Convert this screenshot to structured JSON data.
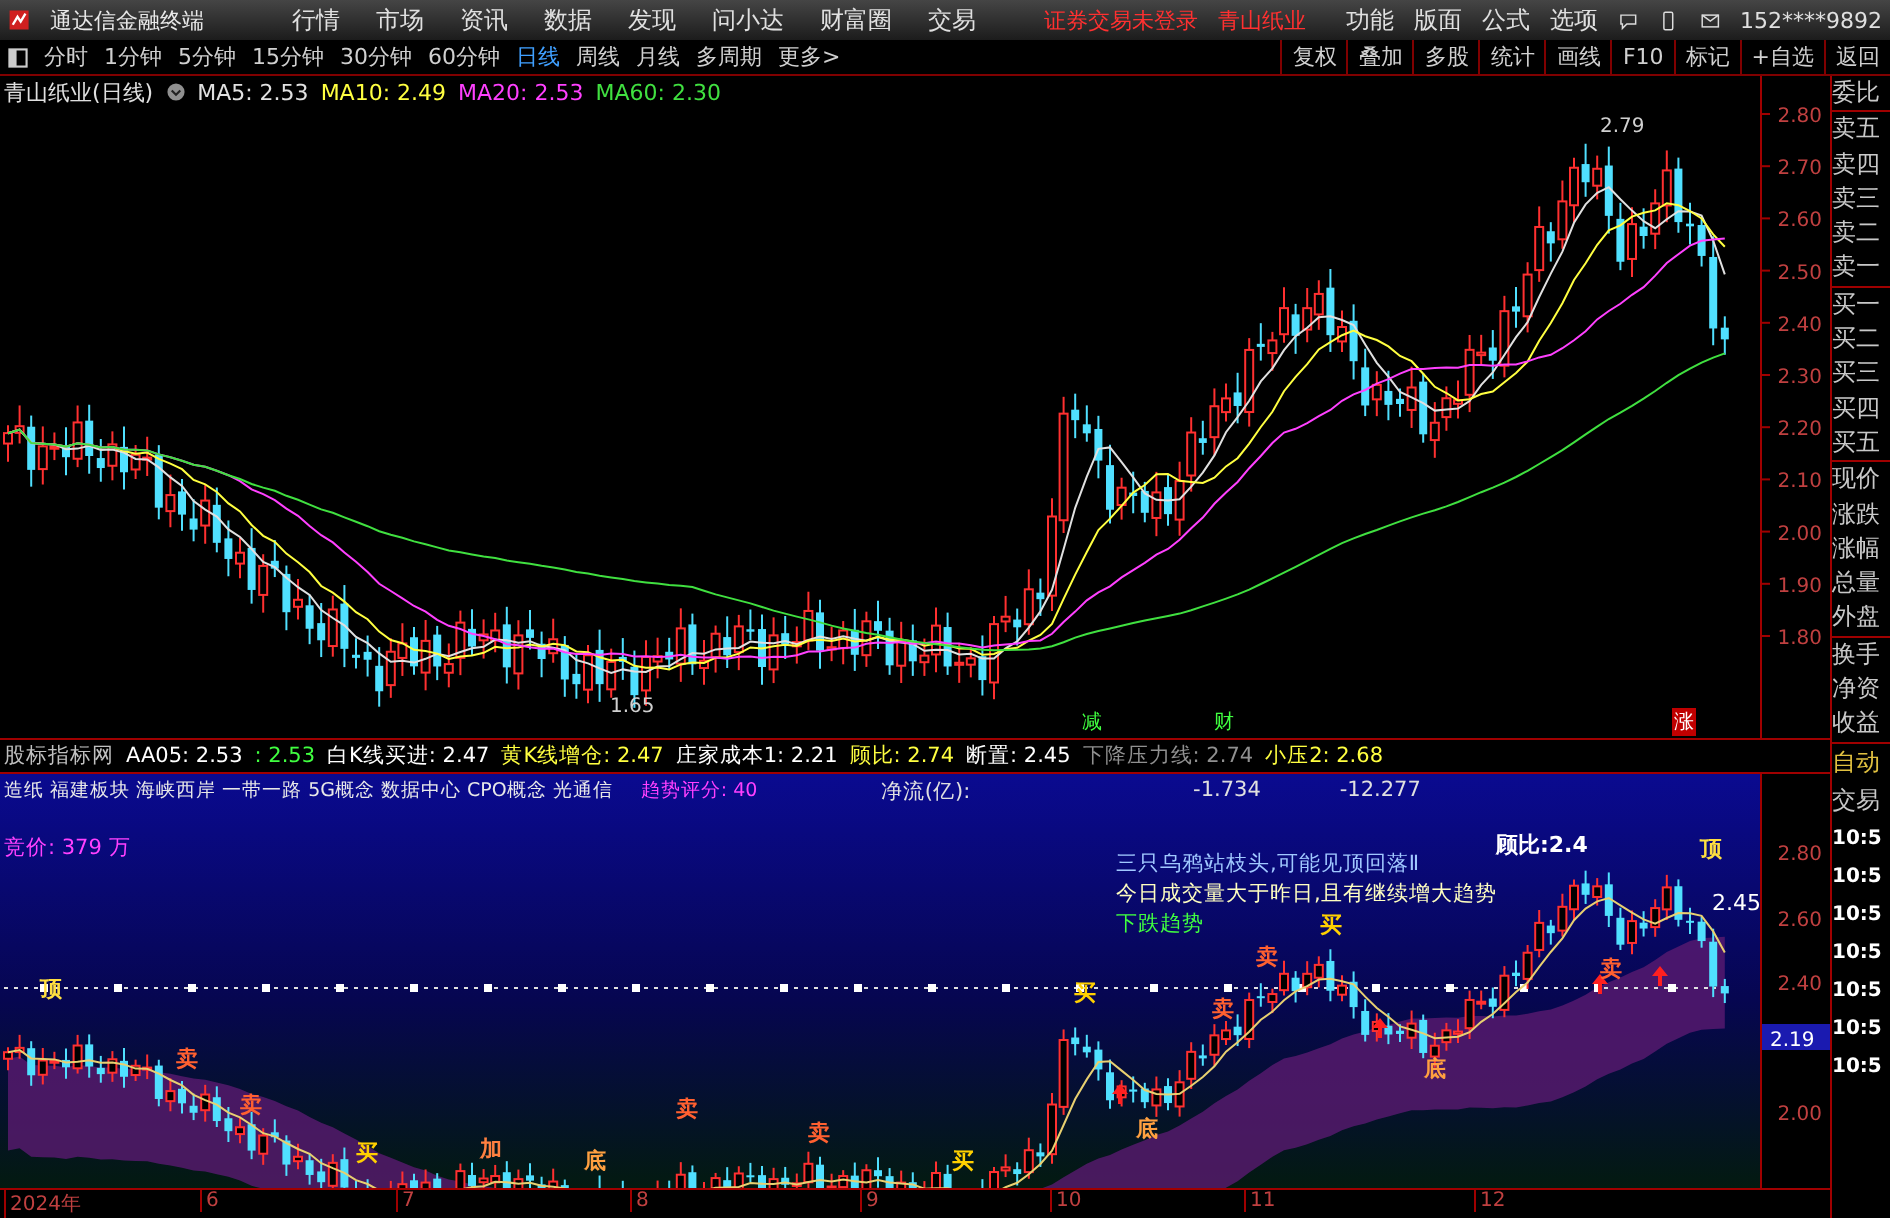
{
  "menubar": {
    "app_title": "通达信金融终端",
    "menus": [
      "行情",
      "市场",
      "资讯",
      "数据",
      "发现",
      "问小达",
      "财富圈",
      "交易"
    ],
    "login_status": "证券交易未登录",
    "stock": "青山纸业",
    "tools": [
      "功能",
      "版面",
      "公式",
      "选项"
    ],
    "account": "152****9892"
  },
  "toolbar": {
    "periods": [
      {
        "label": "分时",
        "selected": false
      },
      {
        "label": "1分钟",
        "selected": false
      },
      {
        "label": "5分钟",
        "selected": false
      },
      {
        "label": "15分钟",
        "selected": false
      },
      {
        "label": "30分钟",
        "selected": false
      },
      {
        "label": "60分钟",
        "selected": false
      },
      {
        "label": "日线",
        "selected": true
      },
      {
        "label": "周线",
        "selected": false
      },
      {
        "label": "月线",
        "selected": false
      },
      {
        "label": "多周期",
        "selected": false
      },
      {
        "label": "更多>",
        "selected": false
      }
    ],
    "actions": [
      "复权",
      "叠加",
      "多股",
      "统计",
      "画线",
      "F10",
      "标记",
      "+自选",
      "返回"
    ]
  },
  "main_chart": {
    "title": "青山纸业(日线)",
    "averages": [
      {
        "label": "MA5: 2.53",
        "color": "#e0e0e0"
      },
      {
        "label": "MA10: 2.49",
        "color": "#ffff40"
      },
      {
        "label": "MA20: 2.53",
        "color": "#ff40ff"
      },
      {
        "label": "MA60: 2.30",
        "color": "#40e040"
      }
    ],
    "price_labels": [
      "2.80",
      "2.70",
      "2.60",
      "2.50",
      "2.40",
      "2.30",
      "2.20",
      "2.10",
      "2.00",
      "1.90",
      "1.80"
    ],
    "annotations": [
      "2.79",
      "1.65"
    ],
    "events": [
      {
        "text": "减",
        "kind": "cut"
      },
      {
        "text": "财",
        "kind": "report"
      },
      {
        "text": "涨",
        "kind": "rise"
      }
    ]
  },
  "indicator": {
    "header": [
      {
        "text": "股标指标网",
        "color": "#c0c0c0"
      },
      {
        "text": "AA05: 2.53",
        "color": "#ffffff"
      },
      {
        "text": ": 2.53",
        "color": "#40ff40"
      },
      {
        "text": "白K线买进: 2.47",
        "color": "#ffffff"
      },
      {
        "text": "黄K线增仓: 2.47",
        "color": "#ffff40"
      },
      {
        "text": "庄家成本1: 2.21",
        "color": "#ffffff"
      },
      {
        "text": "顾比: 2.74",
        "color": "#ffff40"
      },
      {
        "text": "断置: 2.45",
        "color": "#ffffff"
      },
      {
        "text": "下降压力线: 2.74",
        "color": "#909090"
      },
      {
        "text": "小压2: 2.68",
        "color": "#ffff40"
      }
    ],
    "concepts": "造纸 福建板块 海峡西岸 一带一路 5G概念 数据中心 CPO概念 光通信",
    "trend_score": "趋势评分: 40",
    "net_flow_label": "净流(亿):",
    "net_flow_values": [
      "-1.734",
      "-12.277"
    ],
    "auction": "竞价: 379 万",
    "messages": [
      {
        "text": "三只乌鸦站枝头,可能见顶回落Ⅱ",
        "color": "#a0c8ff"
      },
      {
        "text": "今日成交量大于昨日,且有继续增大趋势",
        "color": "#ffffc0"
      },
      {
        "text": "下跌趋势",
        "color": "#40ff40"
      }
    ],
    "signals": [
      {
        "text": "顶",
        "kind": "top"
      },
      {
        "text": "卖",
        "kind": "sell"
      },
      {
        "text": "卖",
        "kind": "sell"
      },
      {
        "text": "买",
        "kind": "buy"
      },
      {
        "text": "加",
        "kind": "add"
      },
      {
        "text": "底",
        "kind": "bottom"
      },
      {
        "text": "卖",
        "kind": "sell"
      },
      {
        "text": "卖",
        "kind": "sell"
      },
      {
        "text": "买",
        "kind": "buy"
      },
      {
        "text": "买",
        "kind": "buy"
      },
      {
        "text": "底",
        "kind": "bottom"
      },
      {
        "text": "卖",
        "kind": "sell"
      },
      {
        "text": "卖",
        "kind": "sell"
      },
      {
        "text": "买",
        "kind": "buy"
      },
      {
        "text": "底",
        "kind": "bottom"
      },
      {
        "text": "顾比:2.4",
        "kind": "note"
      },
      {
        "text": "卖",
        "kind": "sell"
      },
      {
        "text": "顶",
        "kind": "top"
      }
    ],
    "last_value": "2.45",
    "price_labels": [
      {
        "text": "2.80",
        "current": false
      },
      {
        "text": "2.60",
        "current": false
      },
      {
        "text": "2.40",
        "current": false
      },
      {
        "text": "2.19",
        "current": true
      },
      {
        "text": "2.00",
        "current": false
      }
    ]
  },
  "date_axis": [
    "2024年",
    "6",
    "7",
    "8",
    "9",
    "10",
    "11",
    "12"
  ],
  "sidebar": {
    "quote_groups": [
      [
        "委比"
      ],
      [
        "卖五",
        "卖四",
        "卖三",
        "卖二",
        "卖一"
      ],
      [
        "买一",
        "买二",
        "买三",
        "买四",
        "买五"
      ],
      [
        "现价",
        "涨跌",
        "涨幅",
        "总量",
        "外盘"
      ],
      [
        "换手",
        "净资",
        "收益"
      ]
    ],
    "trade": [
      "自动",
      "交易"
    ],
    "times": [
      "10:5",
      "10:5",
      "10:5",
      "10:5",
      "10:5",
      "10:5",
      "10:5"
    ]
  }
}
